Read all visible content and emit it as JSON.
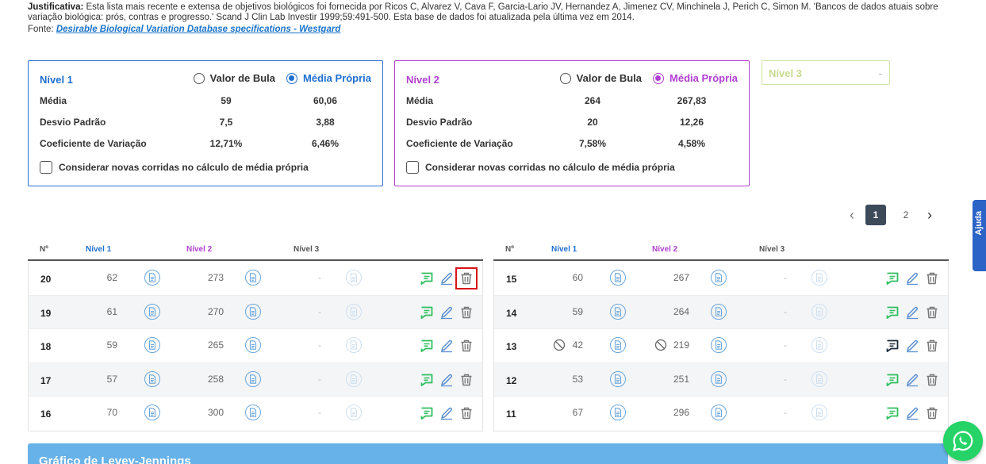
{
  "justificativa": {
    "label": "Justificativa:",
    "text": " Esta lista mais recente e extensa de objetivos biológicos foi fornecida por Ricos C, Alvarez V, Cava F, Garcia-Lario JV, Hernandez A, Jimenez CV, Minchinela J, Perich C, Simon M. 'Bancos de dados atuais sobre variação biológica: prós, contras e progresso.' Scand J Clin Lab Investir 1999;59:491-500. Esta base de dados foi atualizada pela última vez em 2014.",
    "fonte_label": "Fonte:",
    "fonte_link": "Desirable Biological Variation Database specifications - Westgard"
  },
  "levels": [
    {
      "title": "Nível 1",
      "radio_bula": "Valor de Bula",
      "radio_media": "Média Própria",
      "selected": "media",
      "stats": [
        {
          "label": "Média",
          "bula": "59",
          "propria": "60,06"
        },
        {
          "label": "Desvio Padrão",
          "bula": "7,5",
          "propria": "3,88"
        },
        {
          "label": "Coeficiente de Variação",
          "bula": "12,71%",
          "propria": "6,46%"
        }
      ],
      "checkbox": "Considerar novas corridas no cálculo de média própria"
    },
    {
      "title": "Nível 2",
      "radio_bula": "Valor de Bula",
      "radio_media": "Média Própria",
      "selected": "media",
      "stats": [
        {
          "label": "Média",
          "bula": "264",
          "propria": "267,83"
        },
        {
          "label": "Desvio Padrão",
          "bula": "20",
          "propria": "12,26"
        },
        {
          "label": "Coeficiente de Variação",
          "bula": "7,58%",
          "propria": "4,58%"
        }
      ],
      "checkbox": "Considerar novas corridas no cálculo de média própria"
    },
    {
      "title": "Nível 3",
      "value": "-"
    }
  ],
  "pager": {
    "pages": [
      "1",
      "2"
    ],
    "current": "1",
    "prev": "‹",
    "next": "›"
  },
  "table_headers": {
    "no": "Nº",
    "n1": "Nível 1",
    "n2": "Nível 2",
    "n3": "Nível 3"
  },
  "tables": {
    "left": [
      {
        "no": "20",
        "n1": "62",
        "n2": "273",
        "n3": "-"
      },
      {
        "no": "19",
        "n1": "61",
        "n2": "270",
        "n3": "-"
      },
      {
        "no": "18",
        "n1": "59",
        "n2": "265",
        "n3": "-"
      },
      {
        "no": "17",
        "n1": "57",
        "n2": "258",
        "n3": "-"
      },
      {
        "no": "16",
        "n1": "70",
        "n2": "300",
        "n3": "-"
      }
    ],
    "right": [
      {
        "no": "15",
        "n1": "60",
        "n2": "267",
        "n3": "-"
      },
      {
        "no": "14",
        "n1": "59",
        "n2": "264",
        "n3": "-"
      },
      {
        "no": "13",
        "n1": "42",
        "n2": "219",
        "n3": "-"
      },
      {
        "no": "12",
        "n1": "53",
        "n2": "251",
        "n3": "-"
      },
      {
        "no": "11",
        "n1": "67",
        "n2": "296",
        "n3": "-"
      }
    ]
  },
  "help_tab": "Ajuda",
  "chart_section_title": "Gráfico de Levey-Jennings",
  "colors": {
    "level1": "#1f6fd1",
    "level2": "#b03fd0",
    "level3": "#c5db8e",
    "highlight": "#d9141a",
    "whatsapp": "#25d366"
  }
}
